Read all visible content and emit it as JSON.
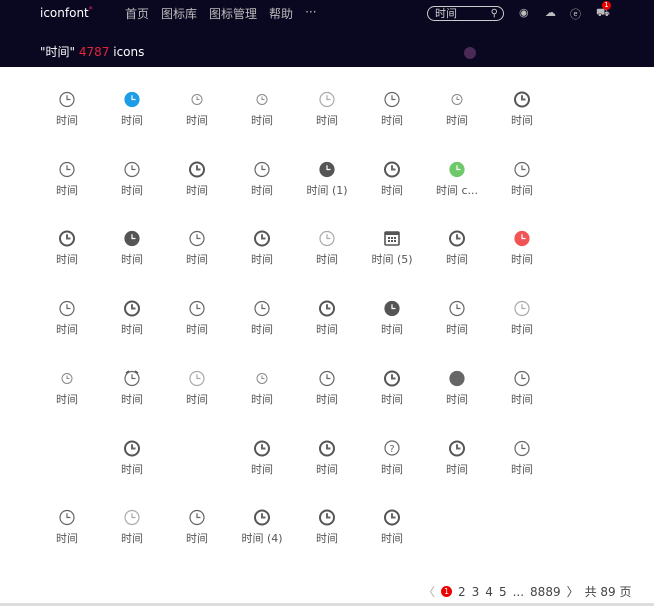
{
  "header": {
    "logo": "iconfont",
    "nav": [
      "首页",
      "图标库",
      "图标管理",
      "帮助",
      "···"
    ],
    "search_value": "时间",
    "cart_count": "1"
  },
  "result": {
    "query": "\"时间\"",
    "count": "4787",
    "suffix": "icons"
  },
  "colors": {
    "accent": "#e0243a",
    "blue": "#1d9ce8",
    "green": "#6fc86a",
    "red": "#f05454",
    "gray": "#666"
  },
  "icons": [
    [
      {
        "l": "时间",
        "s": "o"
      },
      {
        "l": "时间",
        "s": "blue"
      },
      {
        "l": "时间",
        "s": "sm"
      },
      {
        "l": "时间",
        "s": "sm"
      },
      {
        "l": "时间",
        "s": "light"
      },
      {
        "l": "时间",
        "s": "o"
      },
      {
        "l": "时间",
        "s": "sm"
      },
      {
        "l": "时间",
        "s": "bold"
      }
    ],
    [
      {
        "l": "时间",
        "s": "o"
      },
      {
        "l": "时间",
        "s": "o"
      },
      {
        "l": "时间",
        "s": "bold"
      },
      {
        "l": "时间",
        "s": "o"
      },
      {
        "l": "时间 (1)",
        "s": "f"
      },
      {
        "l": "时间",
        "s": "bold"
      },
      {
        "l": "时间 c...",
        "s": "green"
      },
      {
        "l": "时间",
        "s": "o"
      }
    ],
    [
      {
        "l": "时间",
        "s": "bold"
      },
      {
        "l": "时间",
        "s": "f"
      },
      {
        "l": "时间",
        "s": "o"
      },
      {
        "l": "时间",
        "s": "bold"
      },
      {
        "l": "时间",
        "s": "light"
      },
      {
        "l": "时间 (5)",
        "s": "cal"
      },
      {
        "l": "时间",
        "s": "bold"
      },
      {
        "l": "时间",
        "s": "red"
      }
    ],
    [
      {
        "l": "时间",
        "s": "o"
      },
      {
        "l": "时间",
        "s": "bold"
      },
      {
        "l": "时间",
        "s": "o"
      },
      {
        "l": "时间",
        "s": "o"
      },
      {
        "l": "时间",
        "s": "bold"
      },
      {
        "l": "时间",
        "s": "f"
      },
      {
        "l": "时间",
        "s": "o"
      },
      {
        "l": "时间",
        "s": "light"
      }
    ],
    [
      {
        "l": "时间",
        "s": "sm"
      },
      {
        "l": "时间",
        "s": "alarm"
      },
      {
        "l": "时间",
        "s": "light"
      },
      {
        "l": "时间",
        "s": "sm"
      },
      {
        "l": "时间",
        "s": "o"
      },
      {
        "l": "时间",
        "s": "bold"
      },
      {
        "l": "时间",
        "s": "dot"
      },
      {
        "l": "时间",
        "s": "o"
      }
    ],
    [
      null,
      {
        "l": "时间",
        "s": "bold"
      },
      null,
      {
        "l": "时间",
        "s": "bold"
      },
      {
        "l": "时间",
        "s": "bold"
      },
      {
        "l": "时间",
        "s": "q"
      },
      {
        "l": "时间",
        "s": "bold"
      },
      {
        "l": "时间",
        "s": "o"
      }
    ],
    [
      {
        "l": "时间",
        "s": "o"
      },
      {
        "l": "时间",
        "s": "light"
      },
      {
        "l": "时间",
        "s": "o"
      },
      {
        "l": "时间 (4)",
        "s": "bold"
      },
      {
        "l": "时间",
        "s": "bold"
      },
      {
        "l": "时间",
        "s": "bold"
      }
    ]
  ],
  "pager": {
    "prev": "〈",
    "pages": [
      "1",
      "2",
      "3",
      "4",
      "5",
      "...",
      "88",
      "89"
    ],
    "next": "〉",
    "total": "共 89 页"
  }
}
